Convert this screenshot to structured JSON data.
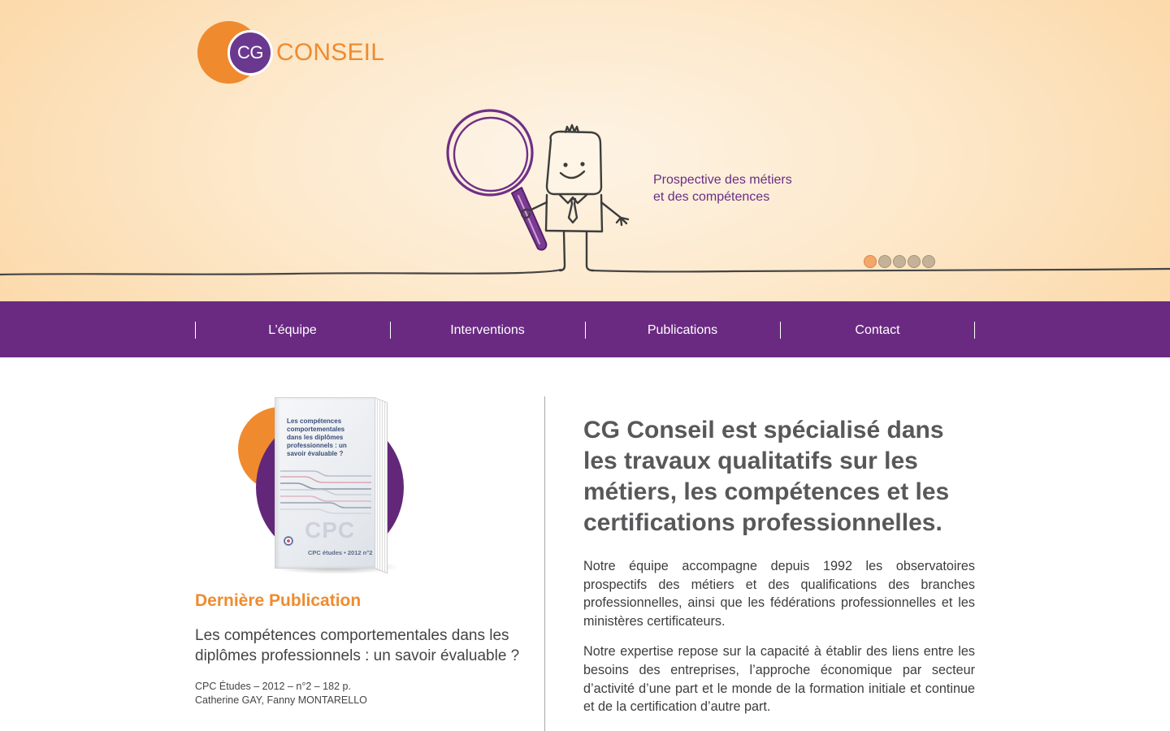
{
  "colors": {
    "purple": "#6a2a82",
    "orange": "#ef8b2e",
    "heading_gray": "#58585a",
    "logo_purple": "#6b3890",
    "tagline_purple": "#6a2d86"
  },
  "brand": {
    "logo_mark": "CG",
    "logo_text": "CONSEIL"
  },
  "hero": {
    "tagline_line1": "Prospective des métiers",
    "tagline_line2": "et des compétences",
    "slider_dots": [
      {
        "active": true
      },
      {
        "active": false
      },
      {
        "active": false
      },
      {
        "active": false
      },
      {
        "active": false
      }
    ]
  },
  "nav": {
    "items": [
      {
        "label": "L’équipe"
      },
      {
        "label": "Interventions"
      },
      {
        "label": "Publications"
      },
      {
        "label": "Contact"
      }
    ]
  },
  "publication": {
    "section_title": "Dernière Publication",
    "title": "Les compétences comportementales dans les diplômes professionnels : un savoir évaluable ?",
    "meta": "CPC Études – 2012 – n°2 – 182 p.",
    "authors": "Catherine GAY, Fanny MONTARELLO",
    "cover": {
      "title": "Les compétences comportementales dans les diplômes professionnels : un savoir évaluable ?",
      "logo": "CPC",
      "series": "CPC études • 2012 n°2"
    }
  },
  "intro": {
    "heading": "CG Conseil est spécialisé dans les travaux qualitatifs sur les métiers, les compétences et les certifications professionnelles.",
    "paragraphs": [
      "Notre équipe accompagne depuis 1992 les observatoires prospectifs des métiers et des qualifications des branches professionnelles, ainsi que les fédérations professionnelles et les ministères certificateurs.",
      "Notre expertise repose sur la capacité à établir des liens entre les besoins des entreprises, l’approche économique par secteur d’activité d’une part et le monde de la formation initiale et continue et de la certification d’autre part."
    ]
  }
}
